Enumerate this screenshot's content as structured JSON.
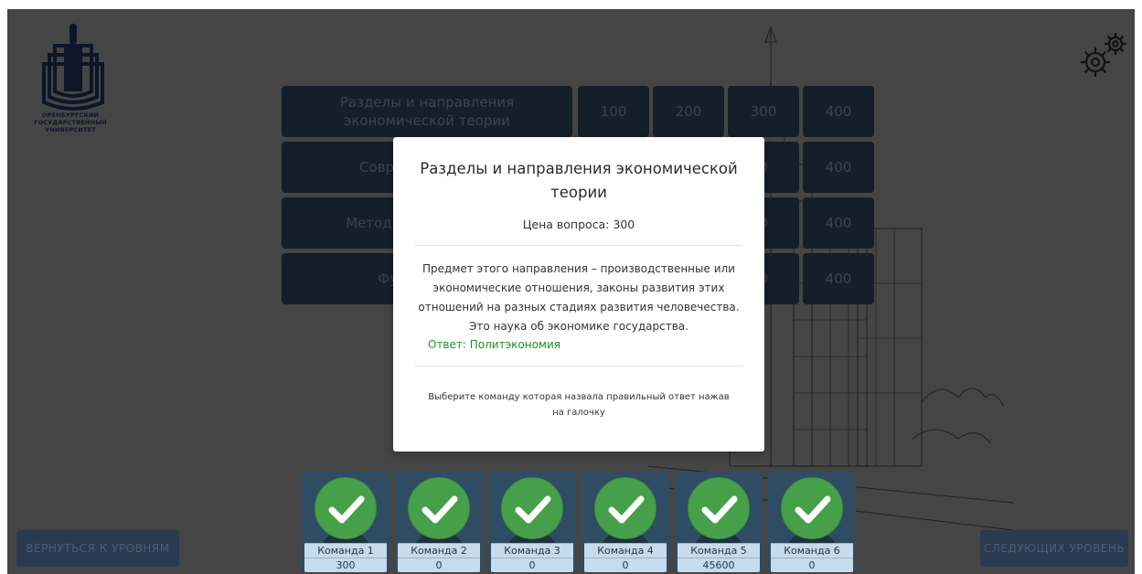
{
  "logo": {
    "line1": "ОРЕНБУРГСКИЙ",
    "line2": "ГОСУДАРСТВЕННЫЙ",
    "line3": "УНИВЕРСИТЕТ"
  },
  "settings_icon": "gear-icon",
  "board": {
    "categories": [
      "Разделы и направления экономической теории",
      "Совреме… эконо…",
      "Методы по… эконом…",
      "Функции эк…"
    ],
    "points": [
      "100",
      "200",
      "300",
      "400"
    ]
  },
  "visible_points": {
    "row2_col3": "0",
    "row2_col4": "400",
    "row3_col3": "0",
    "row3_col4": "400",
    "row4_col3": "0",
    "row4_col4": "400"
  },
  "modal": {
    "title": "Разделы и направления экономической теории",
    "price": "Цена вопроса: 300",
    "question": "Предмет этого направления – производственные или экономические отношения, законы развития этих отношений на разных стадиях развития человечества. Это наука об экономике государства.",
    "answer": "Ответ: Политэкономия",
    "hint": "Выберите команду которая назвала правильный ответ нажав на галочку"
  },
  "buttons": {
    "back": "ВЕРНУТЬСЯ К УРОВНЯМ",
    "next": "СЛЕДУЮЩИХ УРОВЕНЬ"
  },
  "teams": [
    {
      "name": "Команда 1",
      "score": "300"
    },
    {
      "name": "Команда 2",
      "score": "0"
    },
    {
      "name": "Команда 3",
      "score": "0"
    },
    {
      "name": "Команда 4",
      "score": "0"
    },
    {
      "name": "Команда 5",
      "score": "45600"
    },
    {
      "name": "Команда 6",
      "score": "0"
    }
  ],
  "colors": {
    "cell_bg": "#2b3e55",
    "check_green": "#46a049",
    "answer_green": "#1f8f2a",
    "team_label_bg": "#c6dced"
  }
}
